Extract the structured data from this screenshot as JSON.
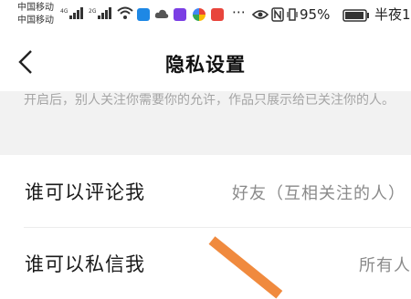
{
  "status_bar": {
    "carrier1": "中国移动",
    "carrier2": "中国移动",
    "net1": "4G",
    "net2": "2G",
    "battery_percent": "95%",
    "time": "半夜1"
  },
  "header": {
    "title": "隐私设置"
  },
  "notice": {
    "text": "开启后，别人关注你需要你的允许，作品只展示给已关注你的人。"
  },
  "settings": [
    {
      "label": "谁可以评论我",
      "value": "好友（互相关注的人）"
    },
    {
      "label": "谁可以私信我",
      "value": "所有人"
    }
  ],
  "colors": {
    "annotation_stroke": "#f08a3e",
    "notice_bg": "#f2f2f2"
  }
}
